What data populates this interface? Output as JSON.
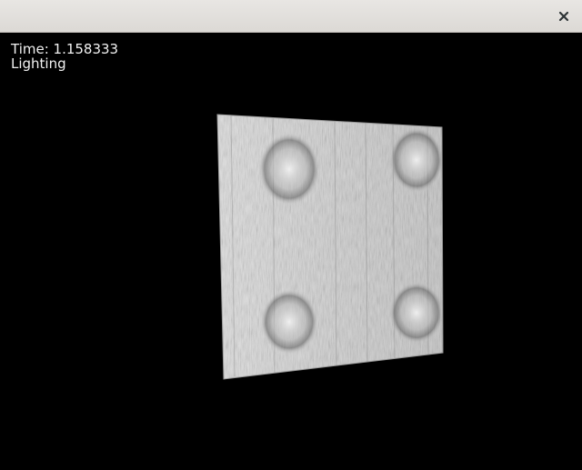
{
  "window": {
    "close_icon": "close-icon"
  },
  "hud": {
    "time_label": "Time: 1.158333",
    "mode_label": "Lighting"
  },
  "colors": {
    "background": "#000000",
    "titlebar": "#dcd9d5",
    "surface": "#d8d8d8",
    "text": "#f2f2f2"
  }
}
